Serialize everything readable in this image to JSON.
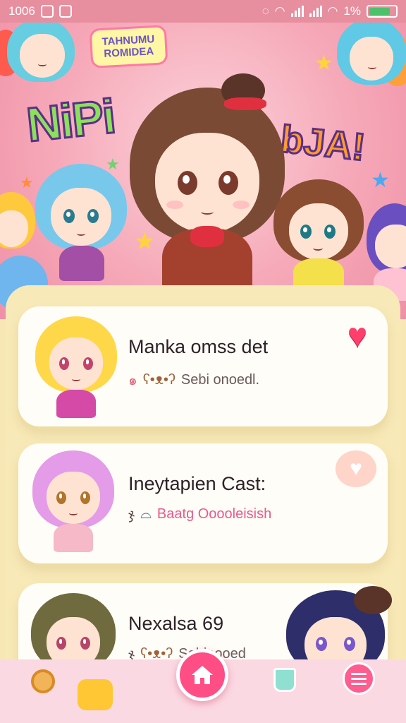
{
  "status_bar": {
    "time": "1006",
    "battery_text": "1%"
  },
  "hero": {
    "sticker_line1": "TAHNUMU",
    "sticker_line2": "ROMIDEA",
    "logo_left": "NiPi",
    "logo_right": "bJA!"
  },
  "cards": [
    {
      "title": "Manka omss det",
      "subtitle": "Sebi onoedl.",
      "favorite": true
    },
    {
      "title": "Ineytapien Cast:",
      "subtitle": "Baatg Ooooleisish",
      "favorite": false
    },
    {
      "title": "Nexalsa 69",
      "subtitle": "Sebiaooed",
      "favorite": false
    }
  ],
  "colors": {
    "status_bar": "#e78f9f",
    "panel": "#f8eab8",
    "accent": "#ff4d86"
  },
  "icons": {
    "home": "home-icon",
    "menu": "menu-icon",
    "heart": "heart-icon"
  }
}
